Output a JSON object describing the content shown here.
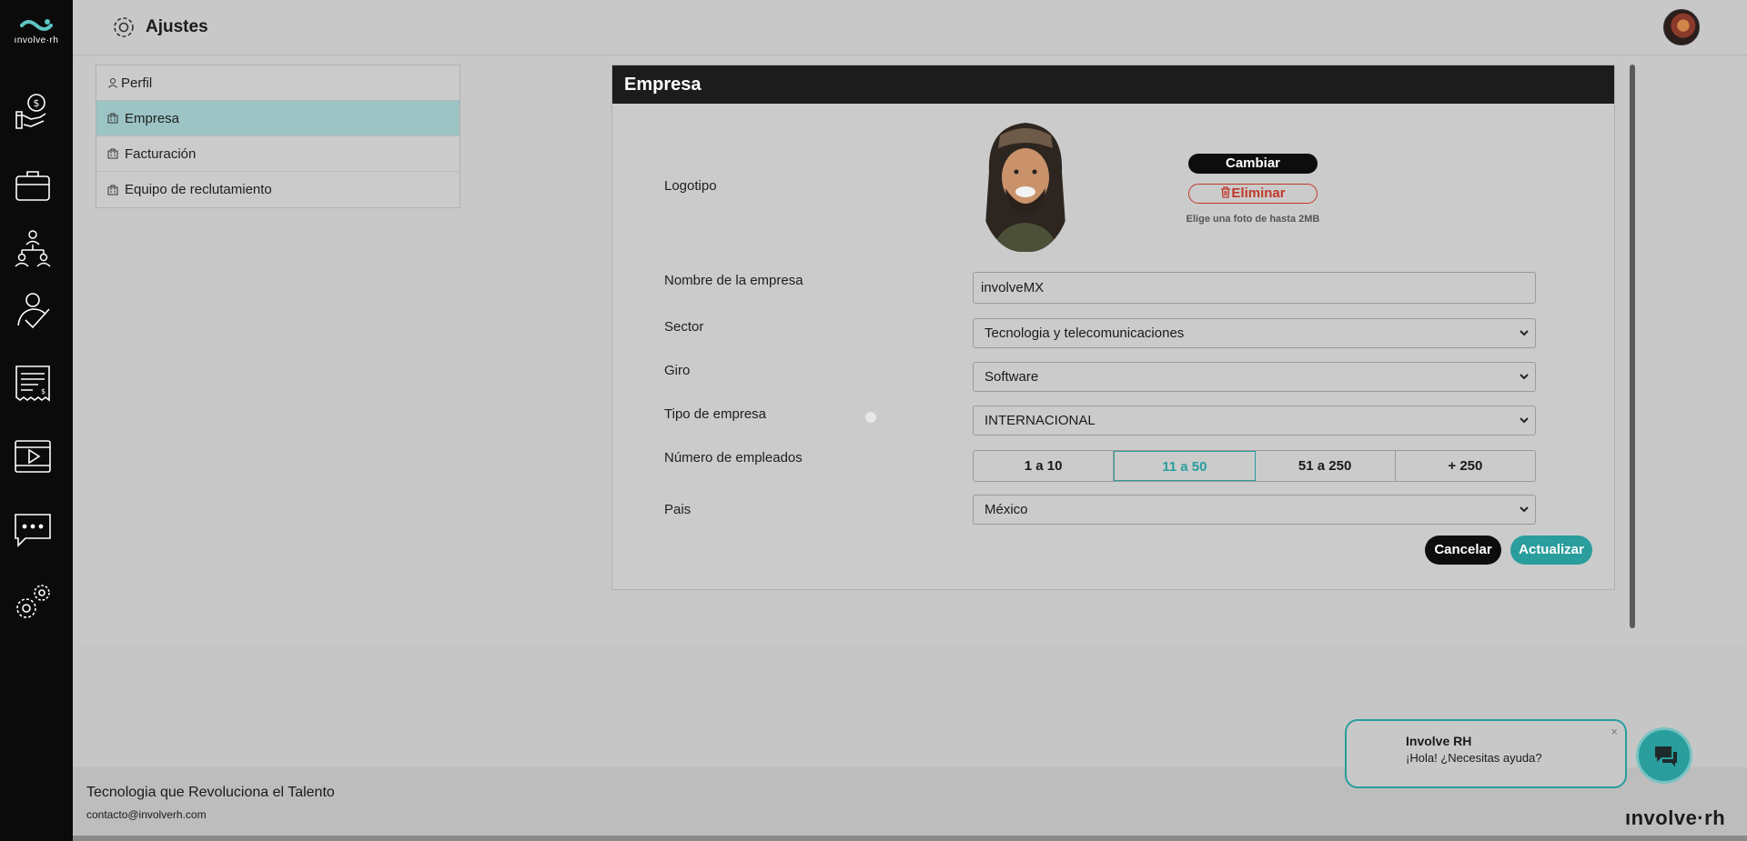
{
  "app": {
    "logo_text": "ınvolve·rh",
    "page_title": "Ajustes"
  },
  "sidebar": {
    "icons": [
      "money-hand-icon",
      "briefcase-icon",
      "team-tree-icon",
      "person-check-icon",
      "invoice-icon",
      "video-icon",
      "chat-icon",
      "settings-gears-icon"
    ]
  },
  "settings_menu": {
    "items": [
      {
        "label": "Perfil",
        "icon": "person-icon",
        "active": false
      },
      {
        "label": "Empresa",
        "icon": "building-icon",
        "active": true
      },
      {
        "label": "Facturación",
        "icon": "building-icon",
        "active": false
      },
      {
        "label": "Equipo de reclutamiento",
        "icon": "building-icon",
        "active": false
      }
    ]
  },
  "company_form": {
    "header": "Empresa",
    "logo_label": "Logotipo",
    "change_button": "Cambiar",
    "delete_button": "Eliminar",
    "photo_hint": "Elige una foto de hasta 2MB",
    "name_label": "Nombre de la empresa",
    "name_value": "involveMX",
    "sector_label": "Sector",
    "sector_value": "Tecnologia y telecomunicaciones",
    "giro_label": "Giro",
    "giro_value": "Software",
    "type_label": "Tipo de empresa",
    "type_value": "INTERNACIONAL",
    "employees_label": "Número de empleados",
    "employee_options": [
      "1 a 10",
      "11 a 50",
      "51 a 250",
      "+ 250"
    ],
    "employee_selected": "11 a 50",
    "country_label": "Pais",
    "country_value": "México",
    "cancel_button": "Cancelar",
    "update_button": "Actualizar"
  },
  "footer": {
    "tagline": "Tecnologia que Revoluciona el Talento",
    "email": "contacto@involverh.com"
  },
  "chat_widget": {
    "name": "Involve RH",
    "message": "¡Hola! ¿Necesitas ayuda?",
    "close": "×",
    "brand": "ınvolve·rh"
  },
  "colors": {
    "accent": "#2a9d9d",
    "danger": "#c0392b",
    "sidebar": "#0b0b0b",
    "active_menu": "#9cc4c4"
  }
}
